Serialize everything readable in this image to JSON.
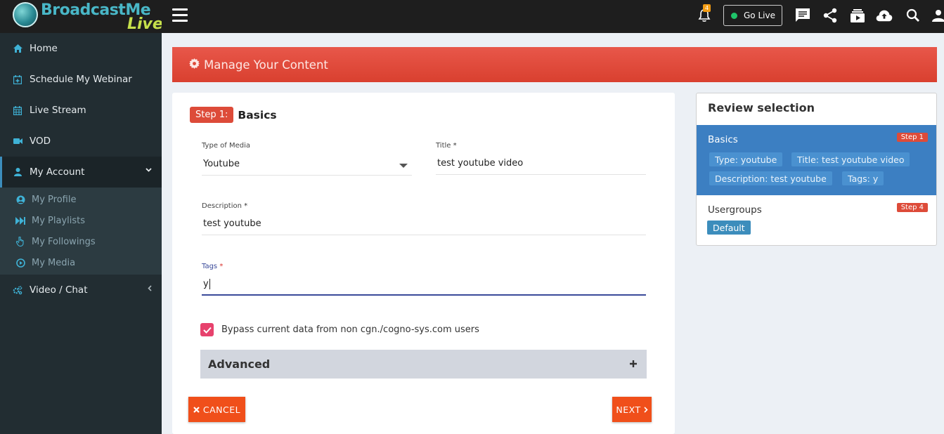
{
  "brand": {
    "name_part1": "BroadcastMe",
    "name_part2": "Live"
  },
  "sidebar": {
    "items": [
      {
        "label": "Home",
        "icon": "home-icon"
      },
      {
        "label": "Schedule My Webinar",
        "icon": "calendar-plus-icon"
      },
      {
        "label": "Live Stream",
        "icon": "calendar-icon"
      },
      {
        "label": "VOD",
        "icon": "video-camera-icon"
      },
      {
        "label": "My Account",
        "icon": "user-icon"
      }
    ],
    "account_submenu": [
      {
        "label": "My Profile",
        "icon": "user-circle-icon"
      },
      {
        "label": "My Playlists",
        "icon": "fast-forward-icon"
      },
      {
        "label": "My Followings",
        "icon": "hand-pointer-icon"
      },
      {
        "label": "My Media",
        "icon": "play-circle-icon"
      }
    ],
    "video_chat": {
      "label": "Video / Chat",
      "icon": "cogs-icon"
    }
  },
  "topbar": {
    "notification_count": "4",
    "go_live_label": "Go Live"
  },
  "banner": {
    "title": "Manage Your Content",
    "icon": "gear-icon"
  },
  "form": {
    "step_badge": "Step 1:",
    "step_name": "Basics",
    "media_type_label": "Type of Media",
    "media_type_value": "Youtube",
    "title_label": "Title",
    "title_value": "test youtube video",
    "description_label": "Description",
    "description_value": "test youtube",
    "tags_label": "Tags",
    "tags_value": "y",
    "required_marker": "*",
    "bypass_label": "Bypass current data from non cgn./cogno-sys.com users",
    "bypass_checked": true,
    "advanced_label": "Advanced",
    "cancel_label": "CANCEL",
    "next_label": "NEXT"
  },
  "review": {
    "title": "Review selection",
    "basics": {
      "heading": "Basics",
      "step": "Step 1",
      "chips": [
        "Type: youtube",
        "Title: test youtube video",
        "Description: test youtube",
        "Tags: y"
      ]
    },
    "usergroups": {
      "heading": "Usergroups",
      "step": "Step 4",
      "chips": [
        "Default"
      ]
    }
  },
  "colors": {
    "banner": "#dd4b39",
    "sidebar_bg": "#222d32",
    "accent_blue": "#3c8dbc",
    "button_orange": "#f04f1a",
    "checkbox_pink": "#e7426d"
  }
}
